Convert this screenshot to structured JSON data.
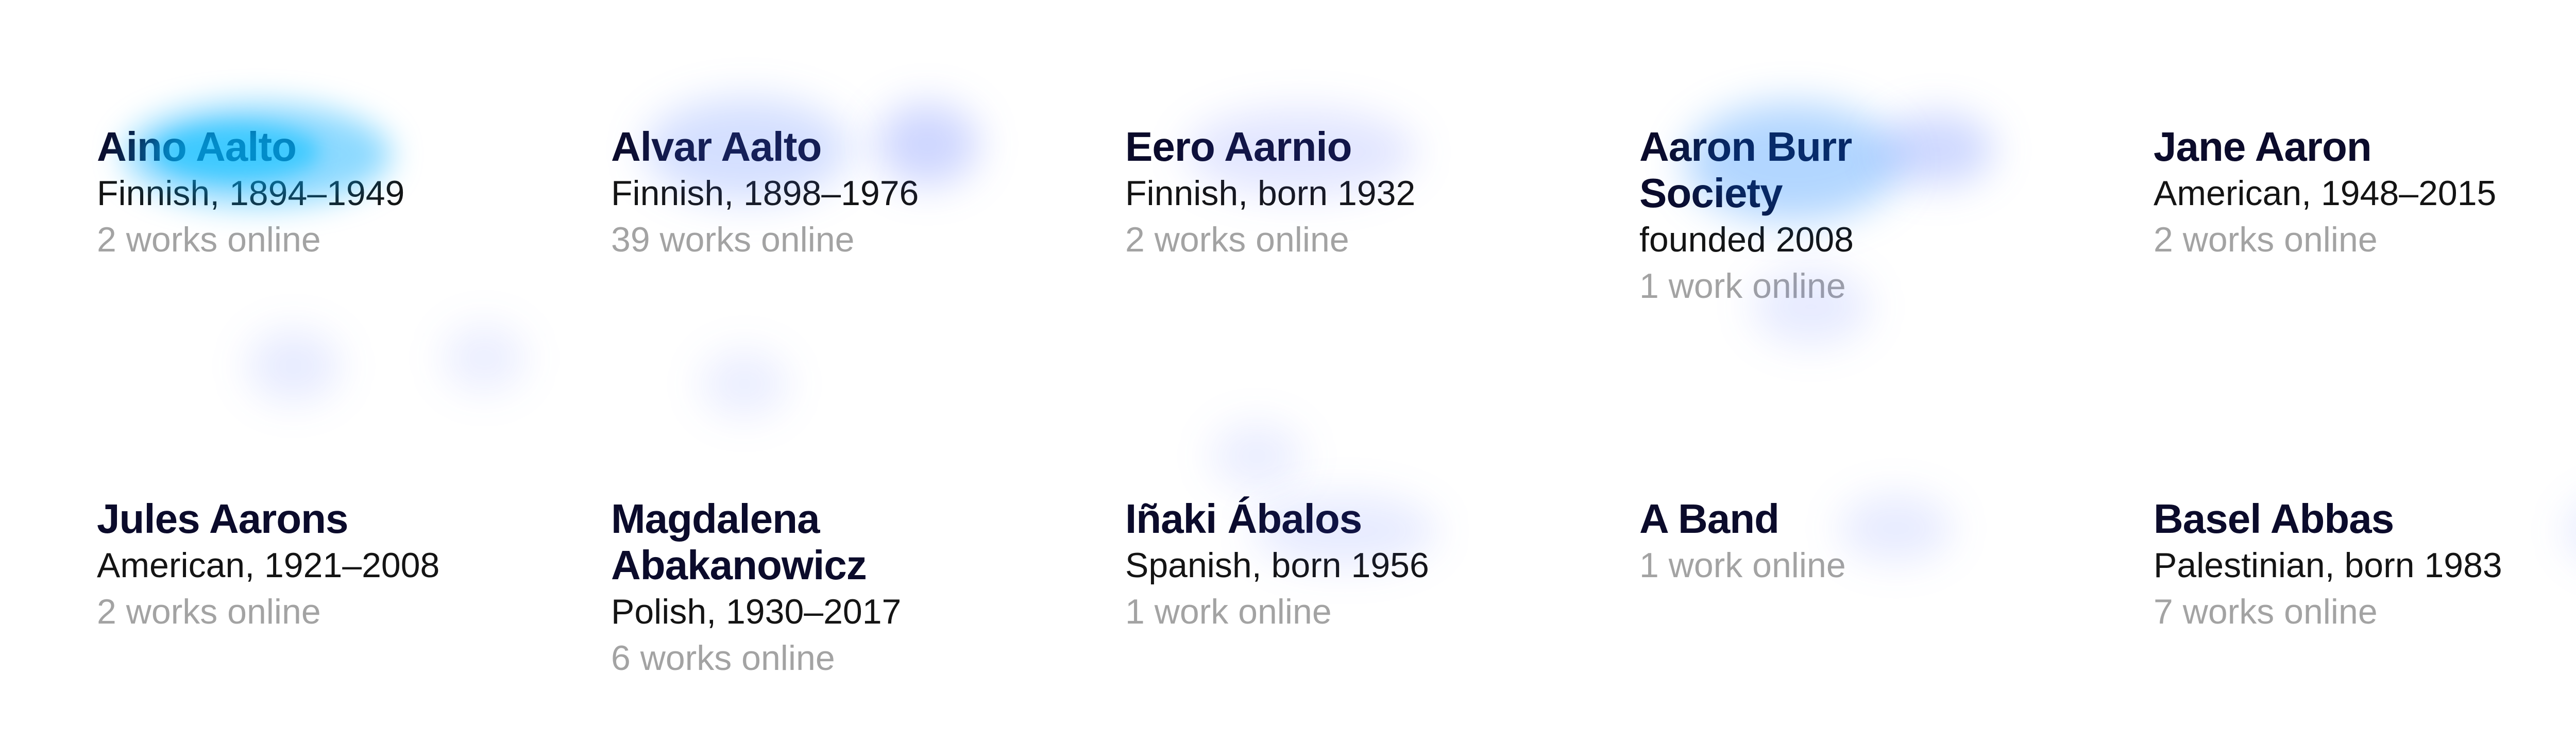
{
  "artists": [
    {
      "name": "Aino Aalto",
      "description": "Finnish, 1894–1949",
      "works": "2 works online"
    },
    {
      "name": "Alvar Aalto",
      "description": "Finnish, 1898–1976",
      "works": "39 works online"
    },
    {
      "name": "Eero Aarnio",
      "description": "Finnish, born 1932",
      "works": "2 works online"
    },
    {
      "name": "Aaron Burr Society",
      "description": "founded 2008",
      "works": "1 work online"
    },
    {
      "name": "Jane Aaron",
      "description": "American, 1948–2015",
      "works": "2 works online"
    },
    {
      "name": "Jules Aarons",
      "description": "American, 1921–2008",
      "works": "2 works online"
    },
    {
      "name": "Magdalena Abakanowicz",
      "description": "Polish, 1930–2017",
      "works": "6 works online"
    },
    {
      "name": "Iñaki Ábalos",
      "description": "Spanish, born 1956",
      "works": "1 work online"
    },
    {
      "name": "A Band",
      "description": null,
      "works": "1 work online"
    },
    {
      "name": "Basel Abbas",
      "description": "Palestinian, born 1983",
      "works": "7 works online"
    }
  ],
  "colors": {
    "name": "#0b0b2b",
    "description": "#141414",
    "works": "#a3a3a3",
    "heatmap": "#466eff"
  }
}
